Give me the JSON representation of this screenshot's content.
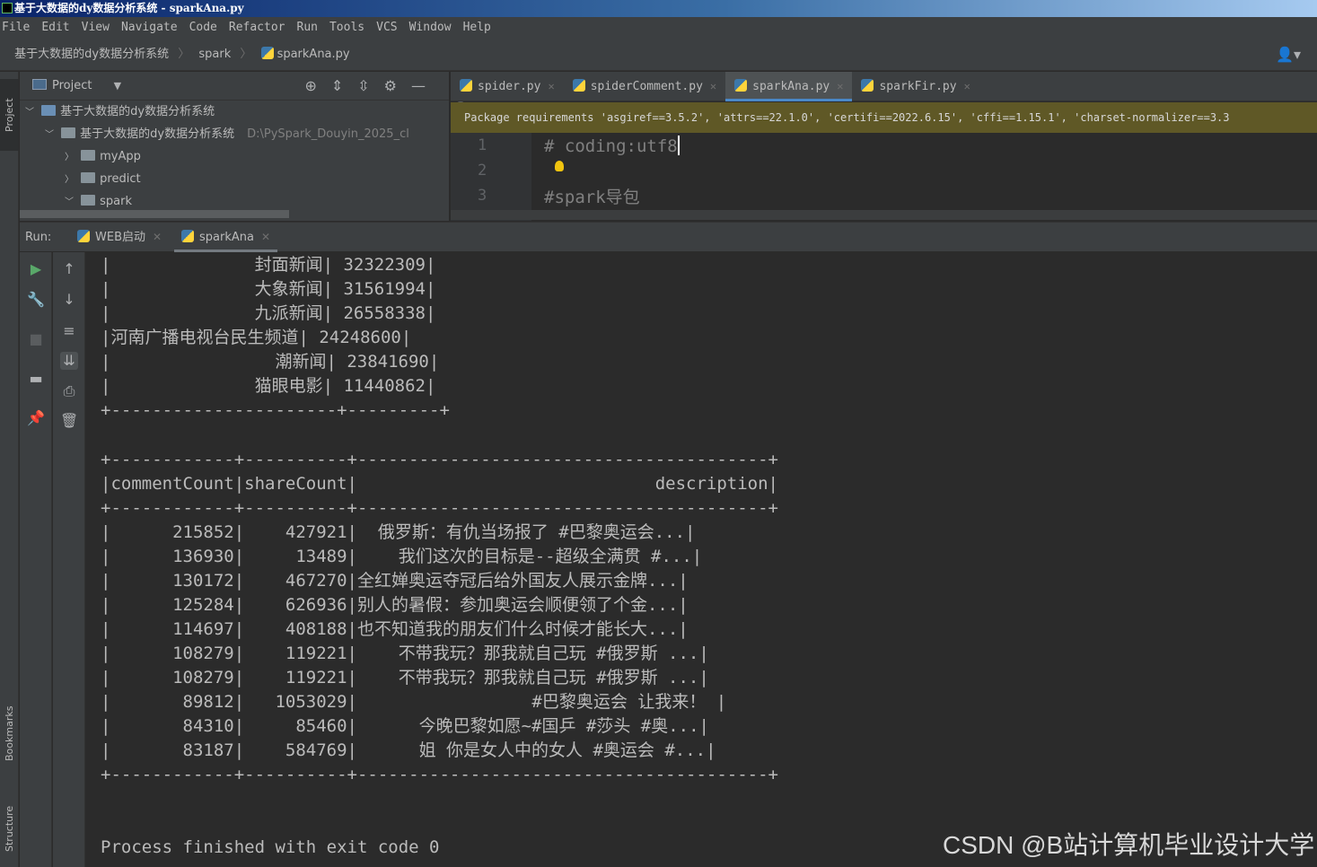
{
  "window": {
    "title": "基于大数据的dy数据分析系统 - sparkAna.py"
  },
  "menu": [
    "File",
    "Edit",
    "View",
    "Navigate",
    "Code",
    "Refactor",
    "Run",
    "Tools",
    "VCS",
    "Window",
    "Help"
  ],
  "breadcrumb": [
    "基于大数据的dy数据分析系统",
    "spark",
    "sparkAna.py"
  ],
  "project_panel": {
    "title": "Project",
    "tree": [
      {
        "label": "基于大数据的dy数据分析系统",
        "expanded": true,
        "path": ""
      },
      {
        "label": "基于大数据的dy数据分析系统",
        "expanded": true,
        "path": "D:\\PySpark_Douyin_2025_cl"
      },
      {
        "label": "myApp",
        "expanded": false,
        "path": ""
      },
      {
        "label": "predict",
        "expanded": false,
        "path": ""
      },
      {
        "label": "spark",
        "expanded": true,
        "path": ""
      }
    ]
  },
  "editor_tabs": [
    {
      "label": "spider.py",
      "active": false
    },
    {
      "label": "spiderComment.py",
      "active": false
    },
    {
      "label": "sparkAna.py",
      "active": true
    },
    {
      "label": "sparkFir.py",
      "active": false
    }
  ],
  "package_banner": "Package requirements 'asgiref==3.5.2', 'attrs==22.1.0', 'certifi==2022.6.15', 'cffi==1.15.1', 'charset-normalizer==3.3",
  "editor_lines": [
    {
      "num": "1",
      "text": "# coding:utf8"
    },
    {
      "num": "2",
      "text": ""
    },
    {
      "num": "3",
      "text": "#spark导包"
    }
  ],
  "run_panel": {
    "label": "Run:",
    "tabs": [
      {
        "label": "WEB启动",
        "active": false
      },
      {
        "label": "sparkAna",
        "active": true
      }
    ]
  },
  "side_tabs": {
    "project": "Project",
    "bookmarks": "Bookmarks",
    "structure": "Structure"
  },
  "console_lines": [
    "|              封面新闻| 32322309|",
    "|              大象新闻| 31561994|",
    "|              九派新闻| 26558338|",
    "|河南广播电视台民生频道| 24248600|",
    "|                潮新闻| 23841690|",
    "|              猫眼电影| 11440862|",
    "+----------------------+---------+",
    "",
    "",
    "+------------+----------+----------------------------------------+",
    "|commentCount|shareCount|                             description|",
    "+------------+----------+----------------------------------------+",
    "|      215852|    427921|  俄罗斯：有仇当场报了 #巴黎奥运会...|",
    "|      136930|     13489|    我们这次的目标是--超级全满贯 #...|",
    "|      130172|    467270|全红婵奥运夺冠后给外国友人展示金牌...|",
    "|      125284|    626936|别人的暑假：参加奥运会顺便领了个金...|",
    "|      114697|    408188|也不知道我的朋友们什么时候才能长大...|",
    "|      108279|    119221|    不带我玩？那我就自己玩 #俄罗斯 ...|",
    "|      108279|    119221|    不带我玩？那我就自己玩 #俄罗斯 ...|",
    "|       89812|   1053029|                 #巴黎奥运会 让我来！ |",
    "|       84310|     85460|      今晚巴黎如愿~#国乒 #莎头 #奥...|",
    "|       83187|    584769|      姐 你是女人中的女人 #奥运会 #...|",
    "+------------+----------+----------------------------------------+",
    "",
    "",
    "Process finished with exit code 0"
  ],
  "watermark": "CSDN @B站计算机毕业设计大学"
}
